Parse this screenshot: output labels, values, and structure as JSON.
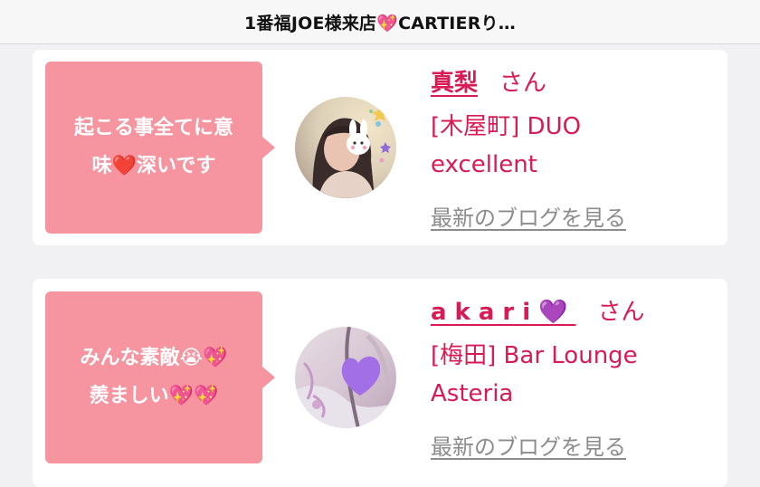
{
  "header": {
    "title": "1番福JOE様来店💖CARTIERり…"
  },
  "cards": [
    {
      "message": "起こる事全てに意味❤️深いです",
      "message_lines": [
        "起こる事全てに意",
        "味❤️深いです"
      ],
      "name": "真梨",
      "honorific": "さん",
      "shop_line1": "[木屋町] DUO",
      "shop_line2": "excellent",
      "blog_link": "最新のブログを見る"
    },
    {
      "message": "みんな素敵😭💖羨ましい💖💖",
      "message_lines": [
        "みんな素敵😭💖",
        "羨ましい💖💖"
      ],
      "name": "akari💜",
      "honorific": "さん",
      "shop_line1": "[梅田] Bar Lounge",
      "shop_line2": "Asteria",
      "blog_link": "最新のブログを見る"
    }
  ],
  "colors": {
    "bubble": "#f6949f",
    "accent": "#d81b54",
    "link": "#8c8c8c"
  }
}
